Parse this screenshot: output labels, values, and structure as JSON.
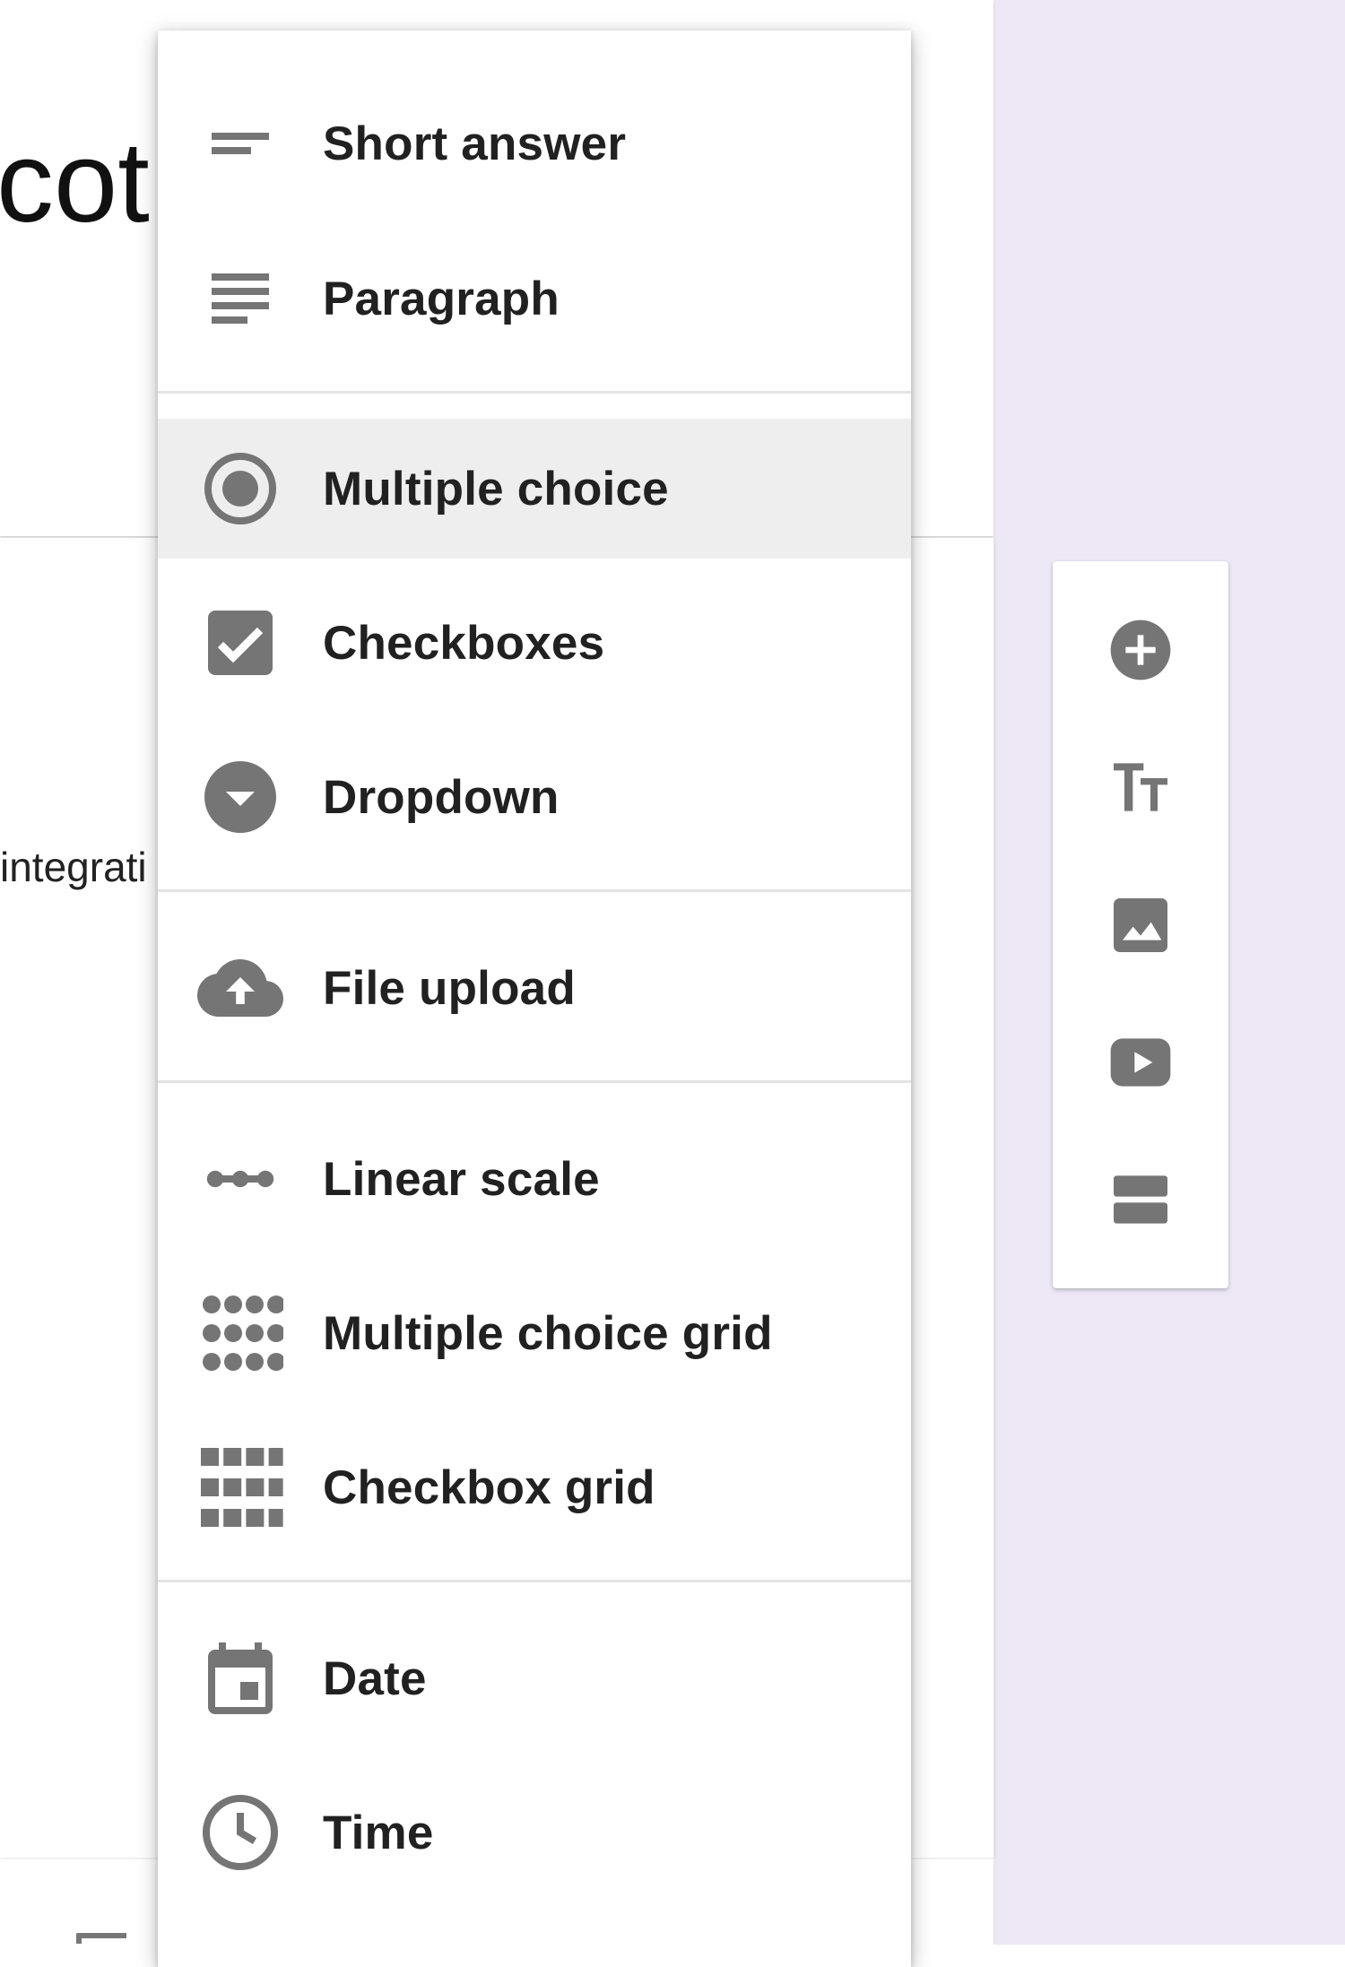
{
  "background": {
    "title_fragment": "cot",
    "description_fragment": "integrati"
  },
  "menu": {
    "items": [
      {
        "label": "Short answer",
        "icon": "short-answer-icon"
      },
      {
        "label": "Paragraph",
        "icon": "paragraph-icon"
      },
      {
        "label": "Multiple choice",
        "icon": "radio-button-icon",
        "selected": true
      },
      {
        "label": "Checkboxes",
        "icon": "checkbox-icon"
      },
      {
        "label": "Dropdown",
        "icon": "dropdown-circle-icon"
      },
      {
        "label": "File upload",
        "icon": "cloud-upload-icon"
      },
      {
        "label": "Linear scale",
        "icon": "linear-scale-icon"
      },
      {
        "label": "Multiple choice grid",
        "icon": "dots-grid-icon"
      },
      {
        "label": "Checkbox grid",
        "icon": "squares-grid-icon"
      },
      {
        "label": "Date",
        "icon": "calendar-icon"
      },
      {
        "label": "Time",
        "icon": "clock-icon"
      }
    ]
  },
  "toolbar": {
    "buttons": [
      {
        "icon": "add-question-icon"
      },
      {
        "icon": "add-title-icon"
      },
      {
        "icon": "add-image-icon"
      },
      {
        "icon": "add-video-icon"
      },
      {
        "icon": "add-section-icon"
      }
    ]
  },
  "colors": {
    "icon": "#757575",
    "text": "#212121",
    "purple_bg": "#ede7f6",
    "selected_bg": "#eeeeee"
  }
}
